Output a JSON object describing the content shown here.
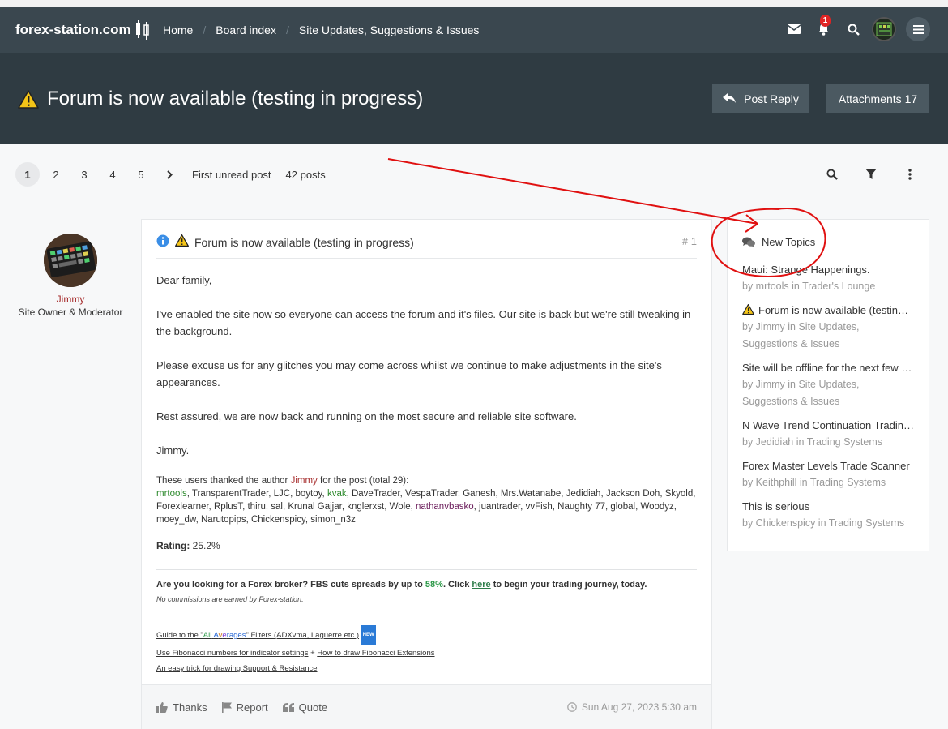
{
  "site": {
    "logo_text": "forex-station.com"
  },
  "nav": {
    "links": [
      "Home",
      "Board index",
      "Site Updates, Suggestions & Issues"
    ],
    "notification_count": "1"
  },
  "topic": {
    "title": "Forum is now available (testing in progress)",
    "post_reply_label": "Post Reply",
    "attachments_label": "Attachments 17"
  },
  "pager": {
    "pages": [
      "1",
      "2",
      "3",
      "4",
      "5"
    ],
    "first_unread": "First unread post",
    "post_count": "42 posts"
  },
  "author": {
    "name": "Jimmy",
    "rank": "Site Owner & Moderator"
  },
  "post": {
    "title": "Forum is now available (testing in progress)",
    "number": "1",
    "greeting": "Dear family,",
    "para1": "I've enabled the site now so everyone can access the forum and it's files. Our site is back but we're still tweaking in the background.",
    "para2": "Please excuse us for any glitches you may come across whilst we continue to make adjustments in the site's appearances.",
    "para3": "Rest assured, we are now back and running on the most secure and reliable site software.",
    "signoff": "Jimmy.",
    "thanks_intro_pre": "These users thanked the author",
    "thanks_intro_author": "Jimmy",
    "thanks_intro_post": "for the post (total 29):",
    "thanks_user_1": "mrtools",
    "thanks_list_a": ", TransparentTrader, LJC, boytoy,",
    "thanks_user_2": "kvak",
    "thanks_list_b": ", DaveTrader, VespaTrader, Ganesh, Mrs.Watanabe, Jedidiah, Jackson Doh, Skyold, Forexlearner, RplusT, thiru, sal, Krunal Gajjar, knglerxst, Wole,",
    "thanks_user_3": "nathanvbasko",
    "thanks_list_c": ", juantrader, vvFish, Naughty 77, global, Woodyz, moey_dw, Narutopips, Chickenspicy, simon_n3z",
    "rating_label": "Rating:",
    "rating_value": "25.2%",
    "ad_text_1": "Are you looking for a Forex broker? FBS cuts spreads by up to",
    "ad_pct": "58%",
    "ad_text_2": ". Click",
    "ad_here": "here",
    "ad_text_3": "to begin your trading journey, today.",
    "ad_note": "No commissions are earned by Forex-station.",
    "link1_pre": "Guide to the \"",
    "link1_all": "All",
    "link1_a": "A",
    "link1_v": "v",
    "link1_e": "e",
    "link1_rages": "rages",
    "link1_post": "\" Filters (ADXvma, Laguerre etc.)",
    "link1_badge": "NEW",
    "link2": "Use Fibonacci numbers for indicator settings",
    "link2_sep": "+",
    "link3": "How to draw Fibonacci Extensions",
    "link4": "An easy trick for drawing Support & Resistance",
    "thanks_btn": "Thanks",
    "report_btn": "Report",
    "quote_btn": "Quote",
    "date": "Sun Aug 27, 2023 5:30 am"
  },
  "sidebar": {
    "heading": "New Topics",
    "topics": [
      {
        "title": "Maui: Strange Happenings.",
        "meta": "by mrtools in Trader's Lounge"
      },
      {
        "title": "Forum is now available (testing in progress)",
        "meta": "by Jimmy in Site Updates, Suggestions & Issues"
      },
      {
        "title": "Site will be offline for the next few hours",
        "meta": "by Jimmy in Site Updates, Suggestions & Issues"
      },
      {
        "title": "N Wave Trend Continuation Trading System",
        "meta": "by Jedidiah in Trading Systems"
      },
      {
        "title": "Forex Master Levels Trade Scanner",
        "meta": "by Keithphill in Trading Systems"
      },
      {
        "title": "This is serious",
        "meta": "by Chickenspicy in Trading Systems"
      }
    ]
  },
  "colors": {
    "navbar": "#3a474f",
    "title_band": "#2f3b42",
    "button": "#4b5961",
    "annotation": "#e01010"
  }
}
